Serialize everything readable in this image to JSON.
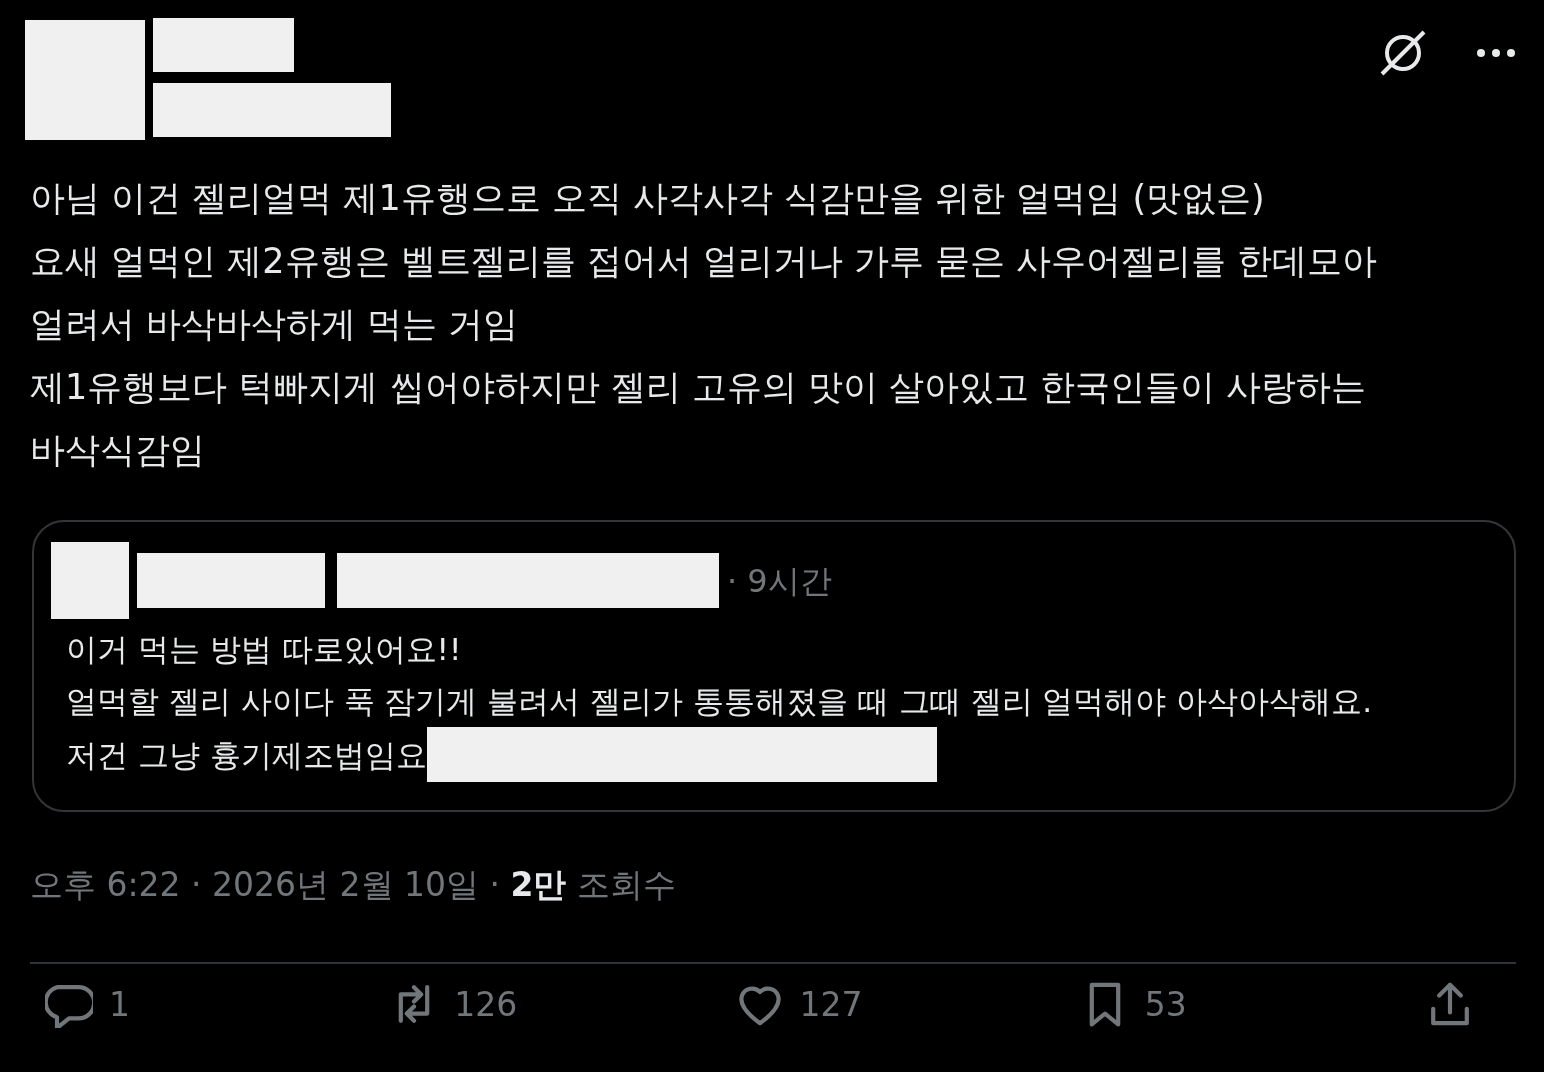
{
  "post": {
    "lines": [
      "아님 이건 젤리얼먹 제1유행으로 오직 사각사각 식감만을 위한 얼먹임 (맛없은)",
      "요새 얼먹인 제2유행은 벨트젤리를 접어서 얼리거나 가루 묻은 사우어젤리를 한데모아",
      "얼려서 바삭바삭하게 먹는 거임",
      "제1유행보다 턱빠지게 씹어야하지만 젤리 고유의 맛이 살아있고 한국인들이 사랑하는",
      "바삭식감임"
    ]
  },
  "quote": {
    "time": "· 9시간",
    "lines": [
      "이거 먹는 방법 따로있어요!!",
      "얼먹할 젤리 사이다 푹 잠기게 불려서 젤리가 통통해졌을 때 그때 젤리 얼먹해야 아삭아삭해요.",
      "저건 그냥 흉기제조법임요"
    ]
  },
  "meta": {
    "time": "오후 6:22 · 2026년 2월 10일",
    "separator": "·",
    "views_count": "2만",
    "views_label": "조회수"
  },
  "actions": [
    {
      "kind": "reply",
      "count": "1"
    },
    {
      "kind": "repost",
      "count": "126"
    },
    {
      "kind": "like",
      "count": "127"
    },
    {
      "kind": "bookmark",
      "count": "53"
    },
    {
      "kind": "share"
    }
  ]
}
